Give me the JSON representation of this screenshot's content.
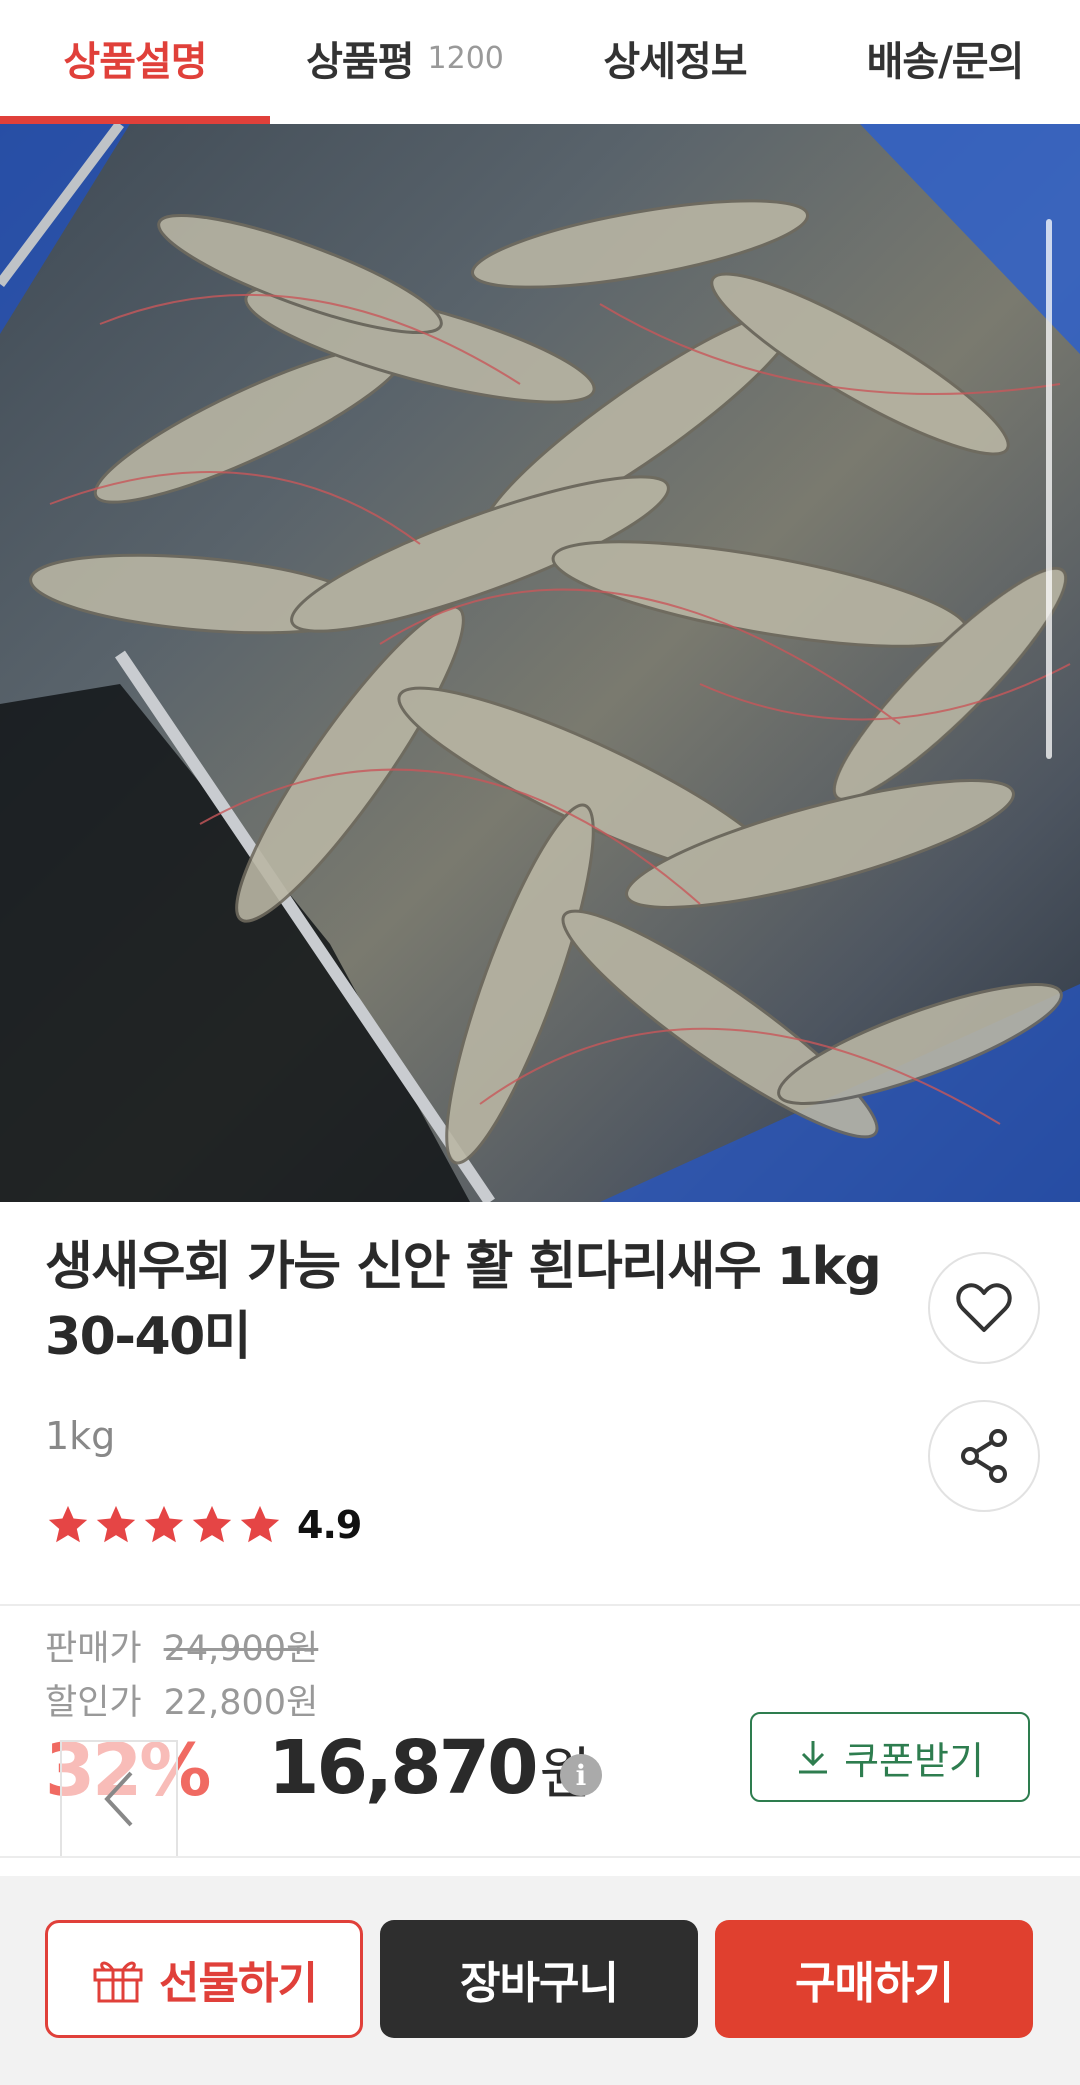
{
  "tabs": [
    {
      "label": "상품설명",
      "active": true
    },
    {
      "label": "상품평",
      "count": "1200",
      "active": false
    },
    {
      "label": "상세정보",
      "active": false
    },
    {
      "label": "배송/문의",
      "active": false
    }
  ],
  "product": {
    "title": "생새우회 가능 신안 활 흰다리새우 1kg 30-40미",
    "weight": "1kg",
    "rating": "4.9",
    "stars": 5
  },
  "price": {
    "sale_label": "판매가",
    "sale_value": "24,900원",
    "discount_label": "할인가",
    "discount_value": "22,800원",
    "discount_percent": "32%",
    "final_price": "16,870",
    "currency": "원",
    "info_icon": "i"
  },
  "coupon": {
    "label": "쿠폰받기"
  },
  "bottom_bar": {
    "gift_label": "선물하기",
    "cart_label": "장바구니",
    "buy_label": "구매하기"
  },
  "icons": {
    "wishlist": "heart-icon",
    "share": "share-icon",
    "download": "download-icon",
    "gift": "gift-icon",
    "back": "chevron-left-icon",
    "info": "info-icon"
  },
  "colors": {
    "accent": "#e0403a",
    "coupon": "#2e7d4f",
    "cart_bg": "#2e2e2e",
    "buy_bg": "#e0402f",
    "star": "#e54545"
  }
}
